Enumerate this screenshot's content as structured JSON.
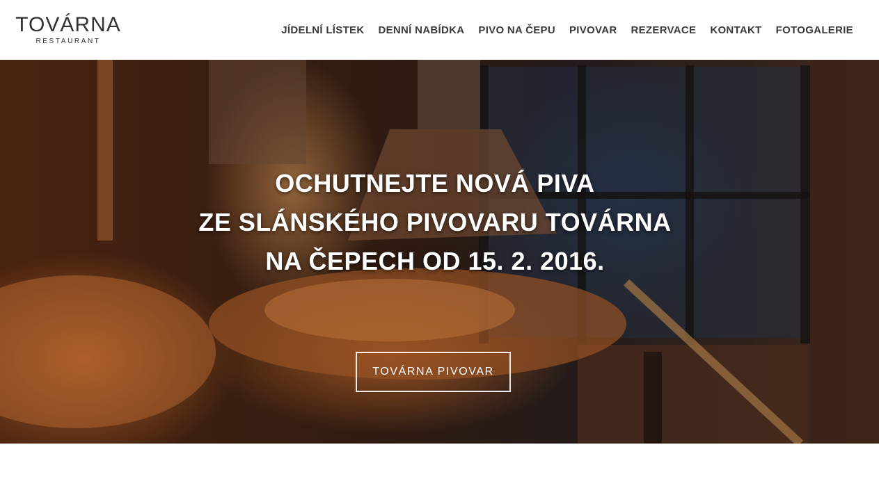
{
  "brand": {
    "name": "TOVÁRNA",
    "tagline": "RESTAURANT"
  },
  "nav": {
    "items": [
      {
        "label": "JÍDELNÍ LÍSTEK"
      },
      {
        "label": "DENNÍ NABÍDKA"
      },
      {
        "label": "PIVO NA ČEPU"
      },
      {
        "label": "PIVOVAR"
      },
      {
        "label": "REZERVACE"
      },
      {
        "label": "KONTAKT"
      },
      {
        "label": "FOTOGALERIE"
      }
    ]
  },
  "hero": {
    "headline_lines": [
      "OCHUTNEJTE NOVÁ PIVA",
      "ZE SLÁNSKÉHO PIVOVARU TOVÁRNA",
      "NA ČEPECH OD 15. 2. 2016."
    ],
    "cta_label": "TOVÁRNA PIVOVAR"
  },
  "colors": {
    "text_dark": "#333333",
    "hero_text": "#ffffff",
    "copper": "#c8743a"
  }
}
